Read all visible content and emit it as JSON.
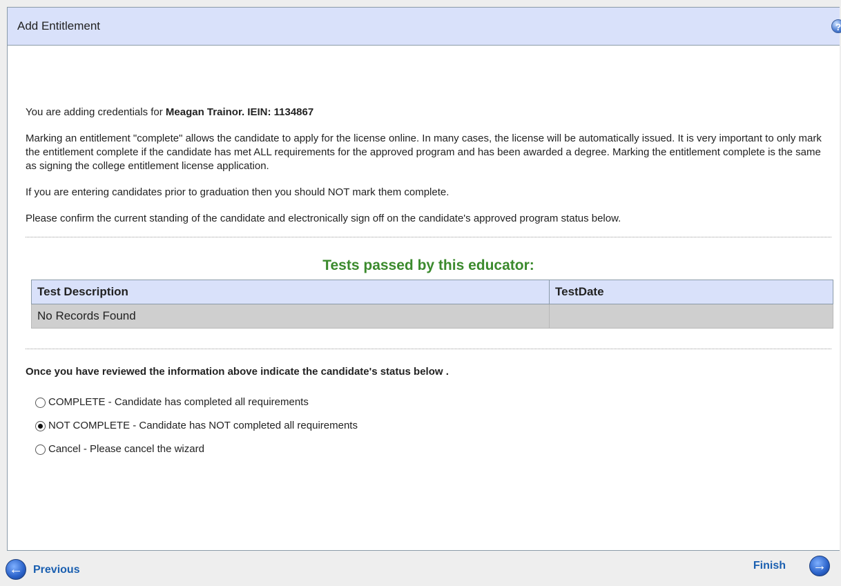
{
  "panel": {
    "title": "Add Entitlement"
  },
  "intro": {
    "prefix": "You are adding credentials for ",
    "candidate": "Meagan Trainor. IEIN: 1134867"
  },
  "paragraphs": [
    "Marking an entitlement \"complete\" allows the candidate to apply for the license online. In many cases, the license will be automatically issued. It is very important to only mark the entitlement complete if the candidate has met ALL requirements for the approved program and has been awarded a degree. Marking the entitlement complete is the same as signing the college entitlement license application.",
    "If you are entering candidates prior to graduation then you should NOT mark them complete.",
    "Please confirm the current standing of the candidate and electronically sign off on the candidate's approved program status below."
  ],
  "tests": {
    "title": "Tests passed by this educator:",
    "columns": [
      "Test Description",
      "TestDate"
    ],
    "empty_message": "No Records Found"
  },
  "status": {
    "instruction": "Once you have reviewed the information above indicate the candidate's status below .",
    "options": [
      {
        "label": "COMPLETE - Candidate has completed all requirements",
        "checked": false
      },
      {
        "label": "NOT COMPLETE - Candidate has NOT completed all requirements",
        "checked": true
      },
      {
        "label": "Cancel - Please cancel the wizard",
        "checked": false
      }
    ]
  },
  "nav": {
    "previous": "Previous",
    "finish": "Finish"
  },
  "icons": {
    "help": "help-icon",
    "previous": "arrow-left-circle-icon",
    "next": "arrow-right-circle-icon"
  },
  "colors": {
    "header_bg": "#d9e1fa",
    "title_green": "#3b8a2d",
    "link_blue": "#1a5fb0"
  }
}
